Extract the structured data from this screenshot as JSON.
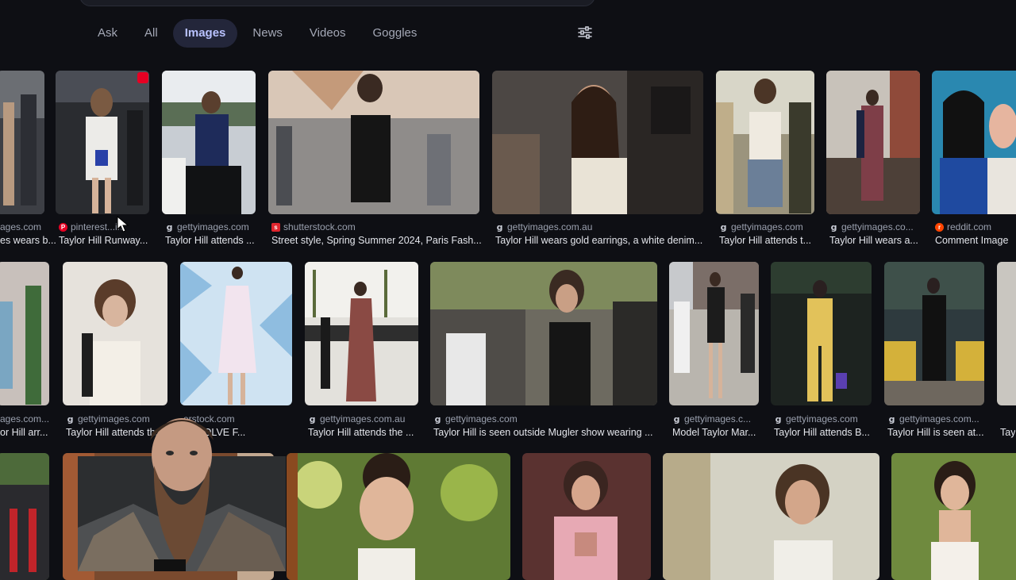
{
  "tabs": [
    {
      "label": "Ask",
      "active": false
    },
    {
      "label": "All",
      "active": false
    },
    {
      "label": "Images",
      "active": true
    },
    {
      "label": "News",
      "active": false
    },
    {
      "label": "Videos",
      "active": false
    },
    {
      "label": "Goggles",
      "active": false
    }
  ],
  "filter_icon": "sliders-icon",
  "colors": {
    "background": "#0e0f14",
    "active_tab_bg": "#23263a",
    "active_tab_text": "#b9c2ff",
    "caption": "#e4e6ec",
    "source": "#9aa0ae"
  },
  "results": {
    "row1": [
      {
        "source": "ages.com",
        "caption": "es wears b...",
        "favicon": "g"
      },
      {
        "source": "pinterest...in",
        "caption": "Taylor Hill Runway...",
        "favicon": "p"
      },
      {
        "source": "gettyimages.com",
        "caption": "Taylor Hill attends ...",
        "favicon": "g"
      },
      {
        "source": "shutterstock.com",
        "caption": "Street style, Spring Summer 2024, Paris Fash...",
        "favicon": "s"
      },
      {
        "source": "gettyimages.com.au",
        "caption": "Taylor Hill wears gold earrings, a white denim...",
        "favicon": "g"
      },
      {
        "source": "gettyimages.com",
        "caption": "Taylor Hill attends t...",
        "favicon": "g"
      },
      {
        "source": "gettyimages.co...",
        "caption": "Taylor Hill wears a...",
        "favicon": "g"
      },
      {
        "source": "reddit.com",
        "caption": "Comment Image",
        "favicon": "r"
      }
    ],
    "row2": [
      {
        "source": "ages.com...",
        "caption": "or Hill arr...",
        "favicon": ""
      },
      {
        "source": "gettyimages.com",
        "caption": "Taylor Hill attends th...",
        "favicon": "g"
      },
      {
        "source": "erstock.com",
        "caption": "REVOLVE F...",
        "favicon": ""
      },
      {
        "source": "gettyimages.com.au",
        "caption": "Taylor Hill attends the ...",
        "favicon": "g"
      },
      {
        "source": "gettyimages.com",
        "caption": "Taylor Hill is seen outside Mugler show wearing ...",
        "favicon": "g"
      },
      {
        "source": "gettyimages.c...",
        "caption": "Model Taylor Mar...",
        "favicon": "g"
      },
      {
        "source": "gettyimages.com",
        "caption": "Taylor Hill attends B...",
        "favicon": "g"
      },
      {
        "source": "gettyimages.com...",
        "caption": "Taylor Hill is seen at...",
        "favicon": "g"
      },
      {
        "source": "",
        "caption": "Tay",
        "favicon": ""
      }
    ]
  }
}
